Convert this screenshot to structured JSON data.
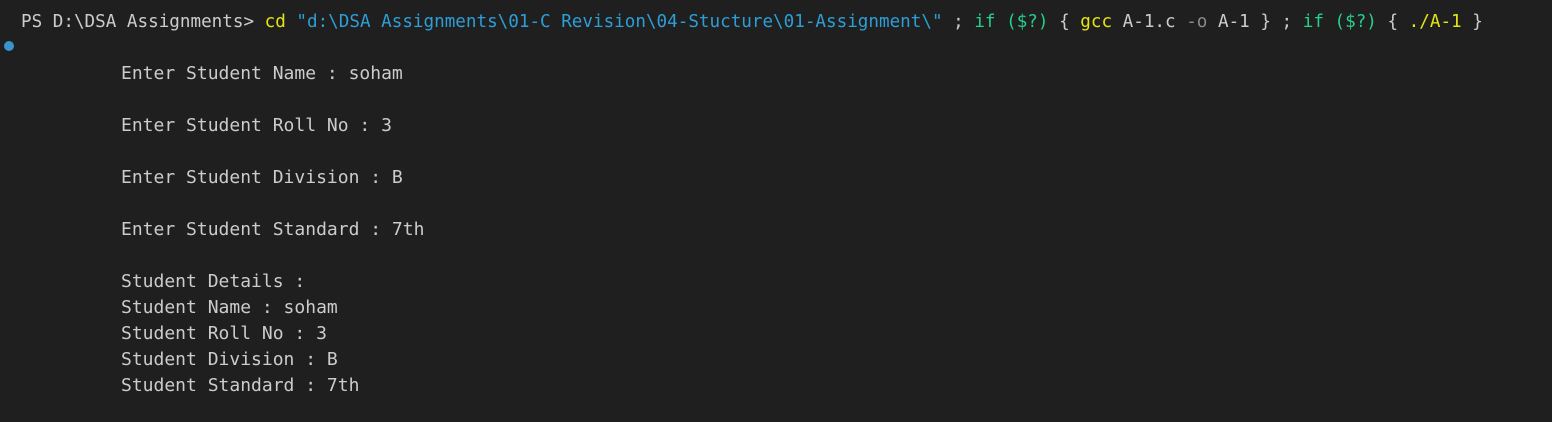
{
  "terminal": {
    "command": {
      "prompt": "PS D:\\DSA Assignments> ",
      "cd": "cd",
      "space1": " ",
      "path": "\"d:\\DSA Assignments\\01-C Revision\\04-Stucture\\01-Assignment\\\"",
      "sep1": " ; ",
      "if1": "if",
      "space2": " ",
      "cond1": "($?)",
      "brace1": " { ",
      "gcc": "gcc",
      "args1": " A-1.c ",
      "flag": "-o",
      "args2": " A-1 } ; ",
      "if2": "if",
      "space3": " ",
      "cond2": "($?)",
      "brace2": " { ",
      "run": "./A-1",
      "brace3": " }"
    },
    "output": [
      "Enter Student Name : soham",
      "Enter Student Roll No : 3",
      "Enter Student Division : B",
      "Enter Student Standard : 7th",
      "Student Details :",
      "Student Name : soham",
      "Student Roll No : 3",
      "Student Division : B",
      "Student Standard : 7th"
    ],
    "colors": {
      "background": "#1f1f1f",
      "text": "#cccccc",
      "keyword_yellow": "#e5e510",
      "string_blue": "#2d9ed6",
      "green": "#23d18b",
      "decoration_blue": "#3794cd"
    }
  }
}
